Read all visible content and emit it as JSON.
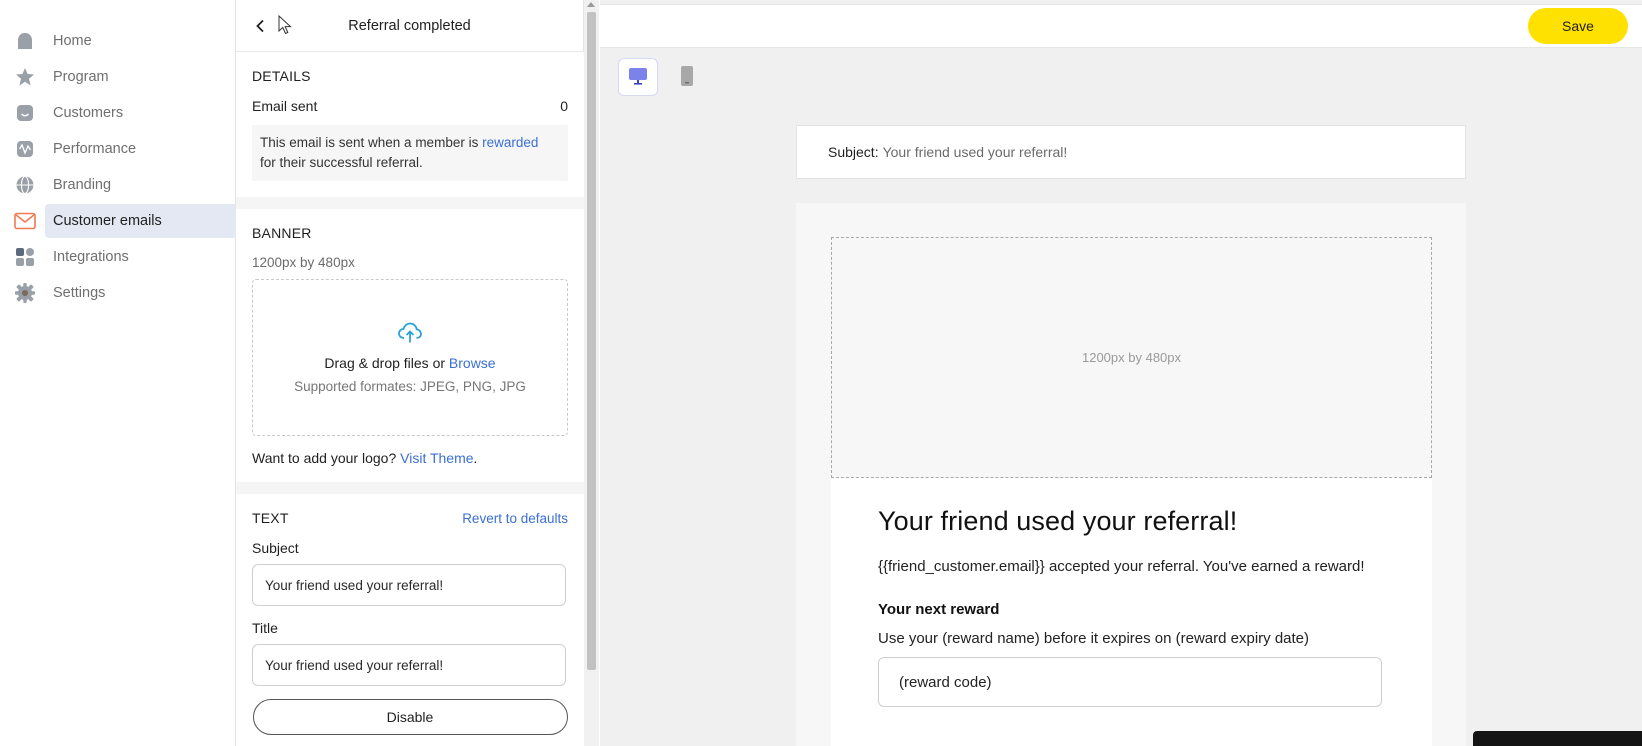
{
  "sidebar": {
    "items": [
      {
        "label": "Home",
        "icon": "home-icon",
        "active": false
      },
      {
        "label": "Program",
        "icon": "star-icon",
        "active": false
      },
      {
        "label": "Customers",
        "icon": "smiley-icon",
        "active": false
      },
      {
        "label": "Performance",
        "icon": "wave-icon",
        "active": false
      },
      {
        "label": "Branding",
        "icon": "globe-icon",
        "active": false
      },
      {
        "label": "Customer emails",
        "icon": "envelope-icon",
        "active": true
      },
      {
        "label": "Integrations",
        "icon": "grid-icon",
        "active": false
      },
      {
        "label": "Settings",
        "icon": "gear-icon",
        "active": false
      }
    ]
  },
  "panel": {
    "title": "Referral completed",
    "details": {
      "heading": "DETAILS",
      "email_sent_label": "Email sent",
      "email_sent_value": "0",
      "info_before": "This email is sent when a member is ",
      "info_link": "rewarded",
      "info_after": "for their successful referral."
    },
    "banner": {
      "heading": "BANNER",
      "size_hint": "1200px by 480px",
      "drop_text": "Drag & drop files or ",
      "browse_link": "Browse",
      "formats": "Supported formates: JPEG, PNG, JPG",
      "logo_question": "Want to add your logo? ",
      "logo_link": "Visit Theme",
      "logo_period": "."
    },
    "text": {
      "heading": "TEXT",
      "revert_link": "Revert to defaults",
      "subject_label": "Subject",
      "subject_value": "Your friend used your referral!",
      "title_label": "Title",
      "title_value": "Your friend used your referral!"
    },
    "disable_label": "Disable"
  },
  "toolbar": {
    "save_label": "Save"
  },
  "preview": {
    "subject_label": "Subject:",
    "subject_value": "Your friend used your referral!",
    "banner_placeholder": "1200px by 480px",
    "email_title": "Your friend used your referral!",
    "email_text": "{{friend_customer.email}} accepted your referral. You've earned a reward!",
    "reward_heading": "Your next reward",
    "reward_text": "Use your (reward name) before it expires on (reward expiry date)",
    "reward_code": "(reward code)"
  },
  "colors": {
    "accent_link": "#3b6fd4",
    "save_button": "#ffe100",
    "active_nav_bg": "#e3e8f2",
    "email_icon": "#f07b4f",
    "upload_icon": "#2aa3d9"
  }
}
